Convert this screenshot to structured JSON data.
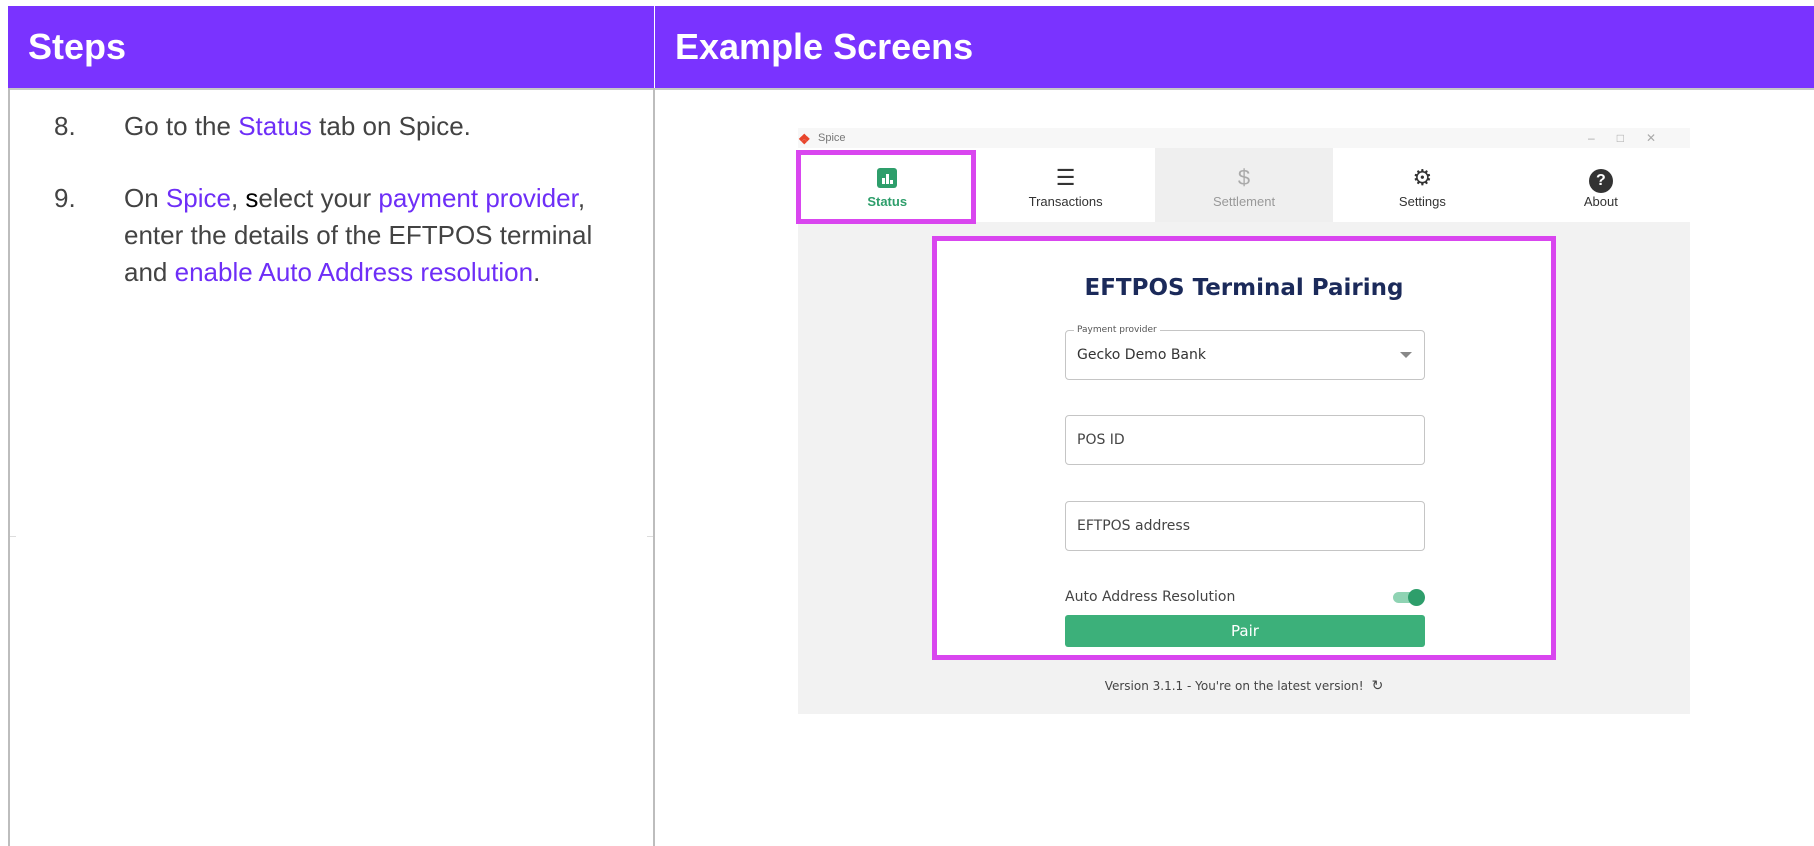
{
  "header": {
    "steps_title": "Steps",
    "examples_title": "Example Screens"
  },
  "steps": [
    {
      "number": "8.",
      "parts": [
        "Go to the ",
        "Status",
        " tab on Spice."
      ]
    },
    {
      "number": "9.",
      "parts": [
        "On ",
        "Spice",
        ", ",
        "s",
        "elect your ",
        "payment provider",
        ",",
        " enter the details of the EFTPOS terminal and ",
        "enable Auto Address resolution",
        "."
      ]
    }
  ],
  "spice": {
    "window_title": "Spice",
    "tabs": [
      {
        "label": "Status",
        "icon": "bar-chart-icon"
      },
      {
        "label": "Transactions",
        "icon": "checklist-icon"
      },
      {
        "label": "Settlement",
        "icon": "hand-dollar-icon"
      },
      {
        "label": "Settings",
        "icon": "gear-icon"
      },
      {
        "label": "About",
        "icon": "question-icon"
      }
    ],
    "pairing": {
      "title": "EFTPOS Terminal Pairing",
      "payment_provider_label": "Payment provider",
      "payment_provider_value": "Gecko Demo Bank",
      "pos_id_placeholder": "POS ID",
      "eftpos_address_placeholder": "EFTPOS address",
      "auto_address_label": "Auto Address Resolution",
      "auto_address_enabled": true,
      "pair_label": "Pair"
    },
    "version_text": "Version 3.1.1 - You're on the latest version!"
  },
  "colors": {
    "accent": "#7a33ff",
    "highlight": "#d946ef",
    "brand_green": "#2e9e6b"
  }
}
